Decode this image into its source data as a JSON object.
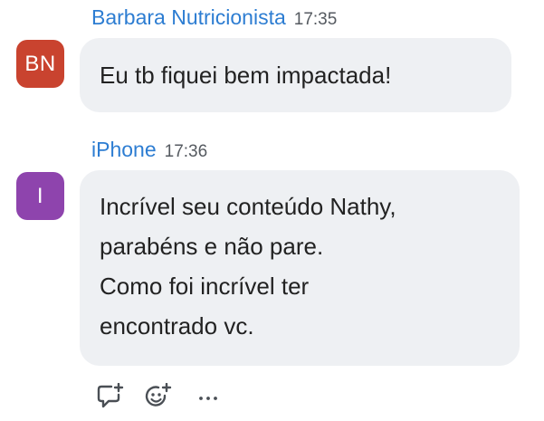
{
  "messages": [
    {
      "sender": "Barbara Nutricionista",
      "time": "17:35",
      "avatar_initials": "BN",
      "avatar_color": "#c9432f",
      "lines": [
        "Eu tb fiquei bem impactada!"
      ]
    },
    {
      "sender": "iPhone",
      "time": "17:36",
      "avatar_initials": "I",
      "avatar_color": "#8e44ad",
      "lines": [
        "Incrível seu conteúdo Nathy,",
        "parabéns e não pare.",
        "Como foi incrível ter",
        "encontrado vc."
      ]
    }
  ],
  "actions": [
    {
      "icon": "reply-comment-icon"
    },
    {
      "icon": "add-reaction-icon"
    },
    {
      "icon": "more-options-icon",
      "label": "···"
    }
  ],
  "colors": {
    "sender_name": "#2d7dd2",
    "bubble_bg": "#eef0f3",
    "timestamp": "#555a60"
  }
}
